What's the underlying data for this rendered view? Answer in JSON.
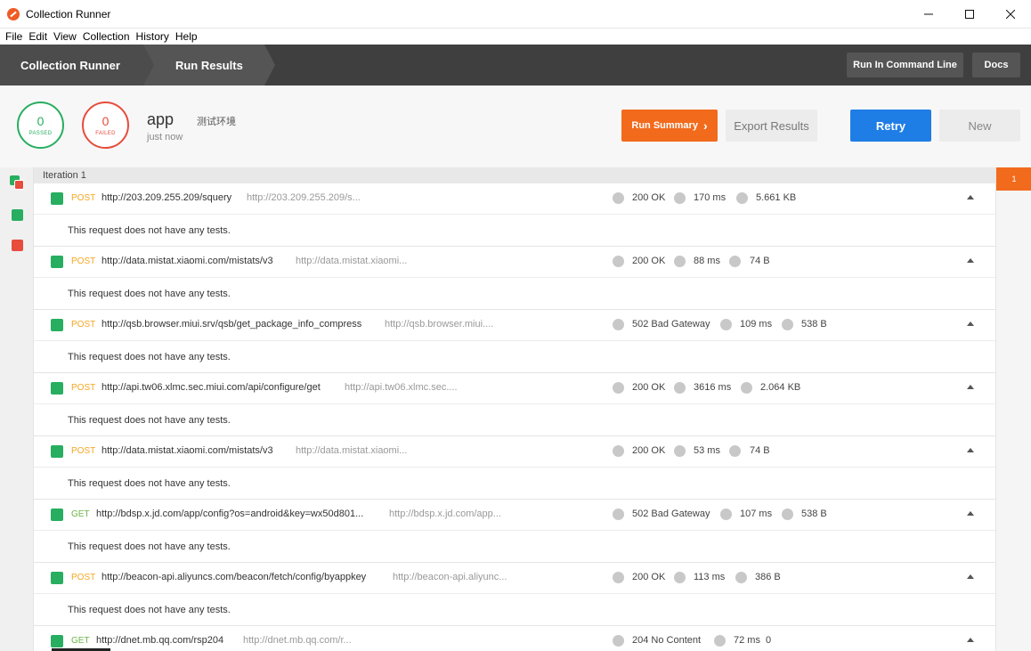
{
  "window": {
    "title": "Collection Runner"
  },
  "menu": [
    "File",
    "Edit",
    "View",
    "Collection",
    "History",
    "Help"
  ],
  "breadcrumbs": [
    "Collection Runner",
    "Run Results"
  ],
  "toolbar": {
    "command_line": "Run In Command Line",
    "docs": "Docs"
  },
  "summary": {
    "passed_count": "0",
    "passed_label": "PASSED",
    "failed_count": "0",
    "failed_label": "FAILED",
    "collection": "app",
    "environment": "测试环境",
    "time": "just now",
    "run_summary": "Run Summary",
    "export": "Export Results",
    "retry": "Retry",
    "new": "New"
  },
  "iteration": {
    "label": "Iteration 1",
    "tab": "1"
  },
  "requests": [
    {
      "method": "POST",
      "url": "http://203.209.255.209/squery",
      "url_short": "http://203.209.255.209/s...",
      "status": "200 OK",
      "time": "170 ms",
      "size": "5.661 KB",
      "tests": "This request does not have any tests."
    },
    {
      "method": "POST",
      "url": "http://data.mistat.xiaomi.com/mistats/v3",
      "url_short": "http://data.mistat.xiaomi...",
      "status": "200 OK",
      "time": "88 ms",
      "size": "74 B",
      "tests": "This request does not have any tests."
    },
    {
      "method": "POST",
      "url": "http://qsb.browser.miui.srv/qsb/get_package_info_compress",
      "url_short": "http://qsb.browser.miui....",
      "status": "502 Bad Gateway",
      "time": "109 ms",
      "size": "538 B",
      "tests": "This request does not have any tests."
    },
    {
      "method": "POST",
      "url": "http://api.tw06.xlmc.sec.miui.com/api/configure/get",
      "url_short": "http://api.tw06.xlmc.sec....",
      "status": "200 OK",
      "time": "3616 ms",
      "size": "2.064 KB",
      "tests": "This request does not have any tests."
    },
    {
      "method": "POST",
      "url": "http://data.mistat.xiaomi.com/mistats/v3",
      "url_short": "http://data.mistat.xiaomi...",
      "status": "200 OK",
      "time": "53 ms",
      "size": "74 B",
      "tests": "This request does not have any tests."
    },
    {
      "method": "GET",
      "url": "http://bdsp.x.jd.com/app/config?os=android&key=wx50d801...",
      "url_short": "http://bdsp.x.jd.com/app...",
      "status": "502 Bad Gateway",
      "time": "107 ms",
      "size": "538 B",
      "tests": "This request does not have any tests."
    },
    {
      "method": "POST",
      "url": "http://beacon-api.aliyuncs.com/beacon/fetch/config/byappkey",
      "url_short": "http://beacon-api.aliyunc...",
      "status": "200 OK",
      "time": "113 ms",
      "size": "386 B",
      "tests": "This request does not have any tests."
    },
    {
      "method": "GET",
      "url": "http://dnet.mb.qq.com/rsp204",
      "url_short": "http://dnet.mb.qq.com/r...",
      "status": "204 No Content",
      "time": "72 ms",
      "size": "0",
      "tests": ""
    }
  ]
}
